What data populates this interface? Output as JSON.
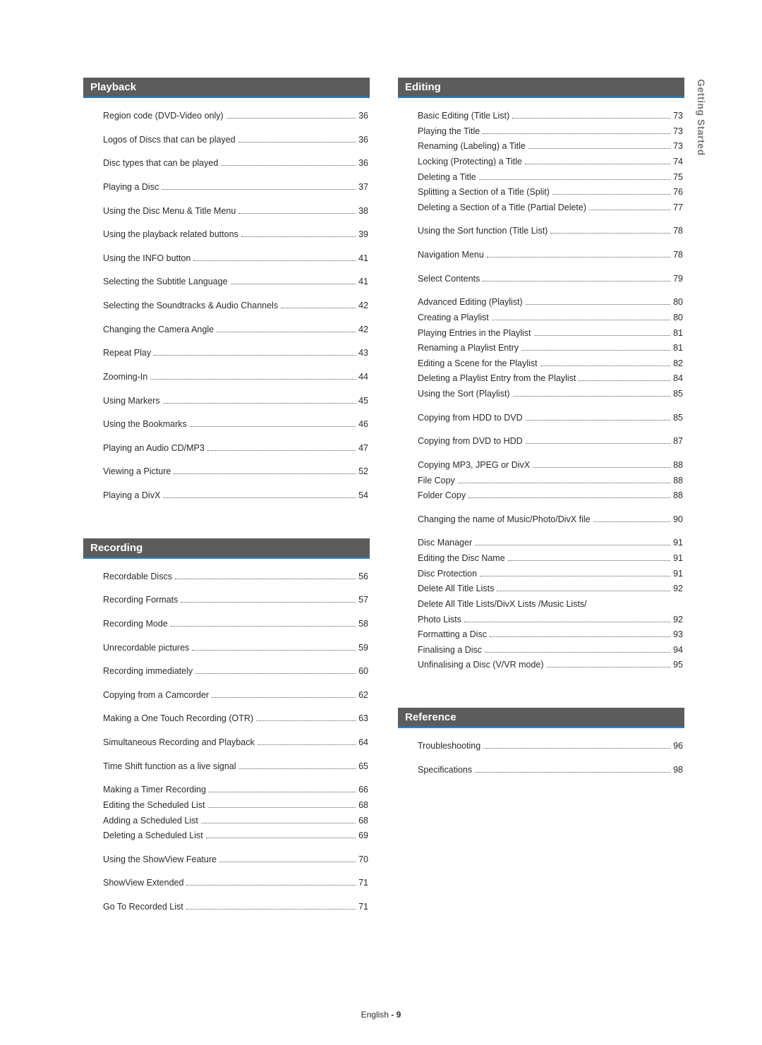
{
  "side_tab": "Getting Started",
  "footer": {
    "language": "English",
    "separator": "-",
    "page": "9"
  },
  "sections": {
    "playback": {
      "title": "Playback",
      "entries": [
        {
          "label": "Region code (DVD-Video only)",
          "page": "36"
        },
        {
          "label": "Logos of Discs that can be played",
          "page": "36"
        },
        {
          "label": "Disc types that can be played",
          "page": "36"
        },
        {
          "label": "Playing a Disc",
          "page": "37"
        },
        {
          "label": "Using the Disc Menu & Title Menu",
          "page": "38"
        },
        {
          "label": "Using the playback related buttons",
          "page": "39"
        },
        {
          "label": "Using the INFO button",
          "page": "41"
        },
        {
          "label": "Selecting the Subtitle Language",
          "page": "41"
        },
        {
          "label": "Selecting the Soundtracks & Audio Channels",
          "page": "42"
        },
        {
          "label": "Changing the Camera Angle",
          "page": "42"
        },
        {
          "label": "Repeat Play",
          "page": "43"
        },
        {
          "label": "Zooming-In",
          "page": "44"
        },
        {
          "label": "Using Markers",
          "page": "45"
        },
        {
          "label": "Using the Bookmarks",
          "page": "46"
        },
        {
          "label": "Playing an Audio CD/MP3",
          "page": "47"
        },
        {
          "label": "Viewing a Picture",
          "page": "52"
        },
        {
          "label": "Playing a DivX",
          "page": "54"
        }
      ]
    },
    "recording": {
      "title": "Recording",
      "entries": [
        {
          "label": "Recordable Discs",
          "page": "56"
        },
        {
          "label": "Recording Formats",
          "page": "57"
        },
        {
          "label": "Recording Mode",
          "page": "58"
        },
        {
          "label": "Unrecordable pictures",
          "page": "59"
        },
        {
          "label": "Recording immediately",
          "page": "60"
        },
        {
          "label": "Copying from a Camcorder",
          "page": "62"
        },
        {
          "label": "Making a One Touch Recording (OTR)",
          "page": "63"
        },
        {
          "label": "Simultaneous Recording and Playback",
          "page": "64"
        },
        {
          "label": "Time Shift function as a live signal",
          "page": "65"
        },
        {
          "label": "Making a Timer Recording",
          "page": "66",
          "group": true
        },
        {
          "label": "Editing the Scheduled List",
          "page": "68",
          "sub": true
        },
        {
          "label": "Adding a Scheduled List",
          "page": "68",
          "sub": true
        },
        {
          "label": "Deleting a Scheduled List",
          "page": "69",
          "sub": true,
          "end": true
        },
        {
          "label": "Using the ShowView Feature",
          "page": "70"
        },
        {
          "label": "ShowView Extended",
          "page": "71"
        },
        {
          "label": "Go To Recorded List",
          "page": "71"
        }
      ]
    },
    "editing": {
      "title": "Editing",
      "entries": [
        {
          "label": "Basic Editing (Title List)",
          "page": "73",
          "group": true
        },
        {
          "label": "Playing the Title",
          "page": "73",
          "sub": true
        },
        {
          "label": "Renaming (Labeling) a Title",
          "page": "73",
          "sub": true
        },
        {
          "label": "Locking (Protecting) a Title",
          "page": "74",
          "sub": true
        },
        {
          "label": "Deleting a Title",
          "page": "75",
          "sub": true
        },
        {
          "label": "Splitting a Section of a Title (Split)",
          "page": "76",
          "sub": true
        },
        {
          "label": "Deleting a Section of a Title (Partial Delete)",
          "page": "77",
          "sub": true,
          "end": true
        },
        {
          "label": "Using the Sort function (Title List)",
          "page": "78"
        },
        {
          "label": "Navigation Menu",
          "page": "78"
        },
        {
          "label": "Select Contents",
          "page": "79"
        },
        {
          "label": "Advanced Editing (Playlist)",
          "page": "80",
          "group": true
        },
        {
          "label": "Creating a Playlist",
          "page": "80",
          "sub": true
        },
        {
          "label": "Playing Entries in the Playlist",
          "page": "81",
          "sub": true
        },
        {
          "label": "Renaming a Playlist Entry",
          "page": "81",
          "sub": true
        },
        {
          "label": "Editing a Scene for the Playlist",
          "page": "82",
          "sub": true
        },
        {
          "label": "Deleting a Playlist Entry from the Playlist",
          "page": "84",
          "sub": true
        },
        {
          "label": "Using the Sort (Playlist)",
          "page": "85",
          "sub": true,
          "end": true
        },
        {
          "label": "Copying from HDD to DVD",
          "page": "85"
        },
        {
          "label": "Copying from DVD to HDD",
          "page": "87"
        },
        {
          "label": "Copying MP3, JPEG or DivX",
          "page": "88",
          "group": true
        },
        {
          "label": "File Copy",
          "page": "88",
          "sub": true
        },
        {
          "label": "Folder Copy",
          "page": "88",
          "sub": true,
          "end": true
        },
        {
          "label": "Changing the name of Music/Photo/DivX file",
          "page": "90"
        },
        {
          "label": "Disc Manager",
          "page": "91",
          "group": true
        },
        {
          "label": "Editing the Disc Name",
          "page": "91",
          "sub": true
        },
        {
          "label": "Disc Protection",
          "page": "91",
          "sub": true
        },
        {
          "label": "Delete All Title Lists",
          "page": "92",
          "sub": true
        },
        {
          "label": "Delete All Title Lists/DivX Lists /Music Lists/",
          "nopage": true,
          "sub": true
        },
        {
          "label": "Photo Lists",
          "page": "92",
          "sub": true
        },
        {
          "label": "Formatting a Disc",
          "page": "93",
          "sub": true
        },
        {
          "label": "Finalising a Disc",
          "page": "94",
          "sub": true
        },
        {
          "label": "Unfinalising a Disc (V/VR mode)",
          "page": "95",
          "sub": true,
          "end": true
        }
      ]
    },
    "reference": {
      "title": "Reference",
      "entries": [
        {
          "label": "Troubleshooting",
          "page": "96"
        },
        {
          "label": "Specifications",
          "page": "98"
        }
      ]
    }
  }
}
